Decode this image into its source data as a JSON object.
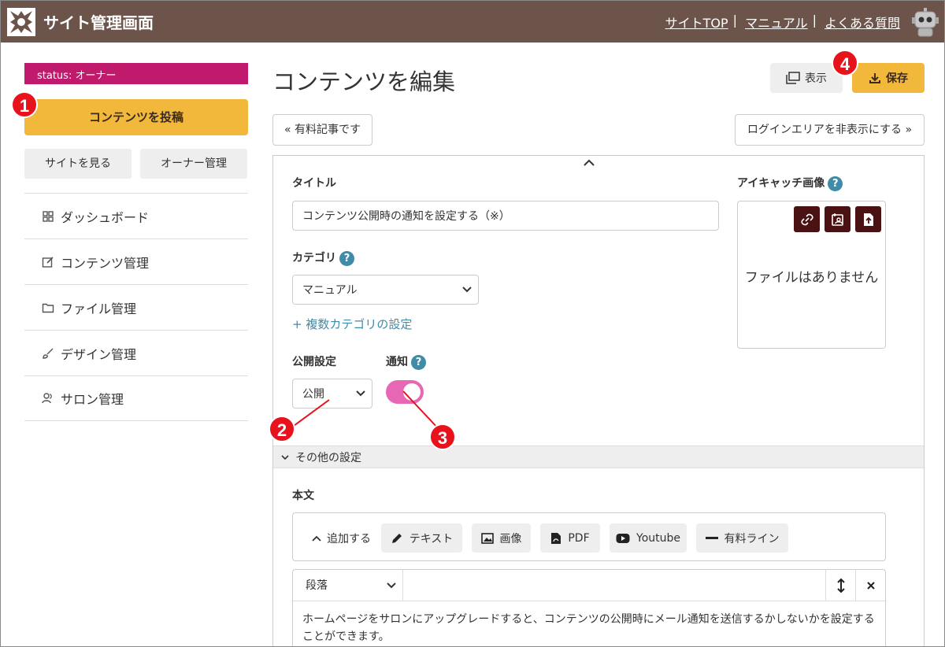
{
  "header": {
    "title": "サイト管理画面",
    "links": [
      "サイトTOP",
      "マニュアル",
      "よくある質問"
    ],
    "separator": "|"
  },
  "sidebar": {
    "status": "status: オーナー",
    "post_button": "コンテンツを投稿",
    "view_site": "サイトを見る",
    "owner_admin": "オーナー管理",
    "items": [
      {
        "label": "ダッシュボード",
        "icon": "grid-icon"
      },
      {
        "label": "コンテンツ管理",
        "icon": "edit-icon"
      },
      {
        "label": "ファイル管理",
        "icon": "folder-icon"
      },
      {
        "label": "デザイン管理",
        "icon": "brush-icon"
      },
      {
        "label": "サロン管理",
        "icon": "users-icon"
      }
    ]
  },
  "main": {
    "title": "コンテンツを編集",
    "view_button": "表示",
    "save_button": "保存",
    "paid_article": "« 有料記事です",
    "hide_login": "ログインエリアを非表示にする »",
    "title_label": "タイトル",
    "title_value": "コンテンツ公開時の通知を設定する（※）",
    "category_label": "カテゴリ",
    "category_value": "マニュアル",
    "multi_category": "+ 複数カテゴリの設定",
    "publish_label": "公開設定",
    "publish_value": "公開",
    "notify_label": "通知",
    "notify_on": true,
    "eyecatch_label": "アイキャッチ画像",
    "no_file": "ファイルはありません",
    "help_mark": "?",
    "other_settings": "その他の設定",
    "body_label": "本文",
    "add_toggle": "追加する",
    "tools": [
      "テキスト",
      "画像",
      "PDF",
      "Youtube",
      "有料ライン"
    ],
    "paragraph": "段落",
    "body_text": "ホームページをサロンにアップグレードすると、コンテンツの公開時にメール通知を送信するかしないかを設定することができます。"
  },
  "callouts": [
    "1",
    "2",
    "3",
    "4"
  ],
  "colors": {
    "header_bg": "#6d544b",
    "status_bg": "#c01a6c",
    "accent_yellow": "#f2b83b",
    "toggle_pink": "#e867b5",
    "help_blue": "#3f8ba8",
    "callout_red": "#e8121d"
  }
}
